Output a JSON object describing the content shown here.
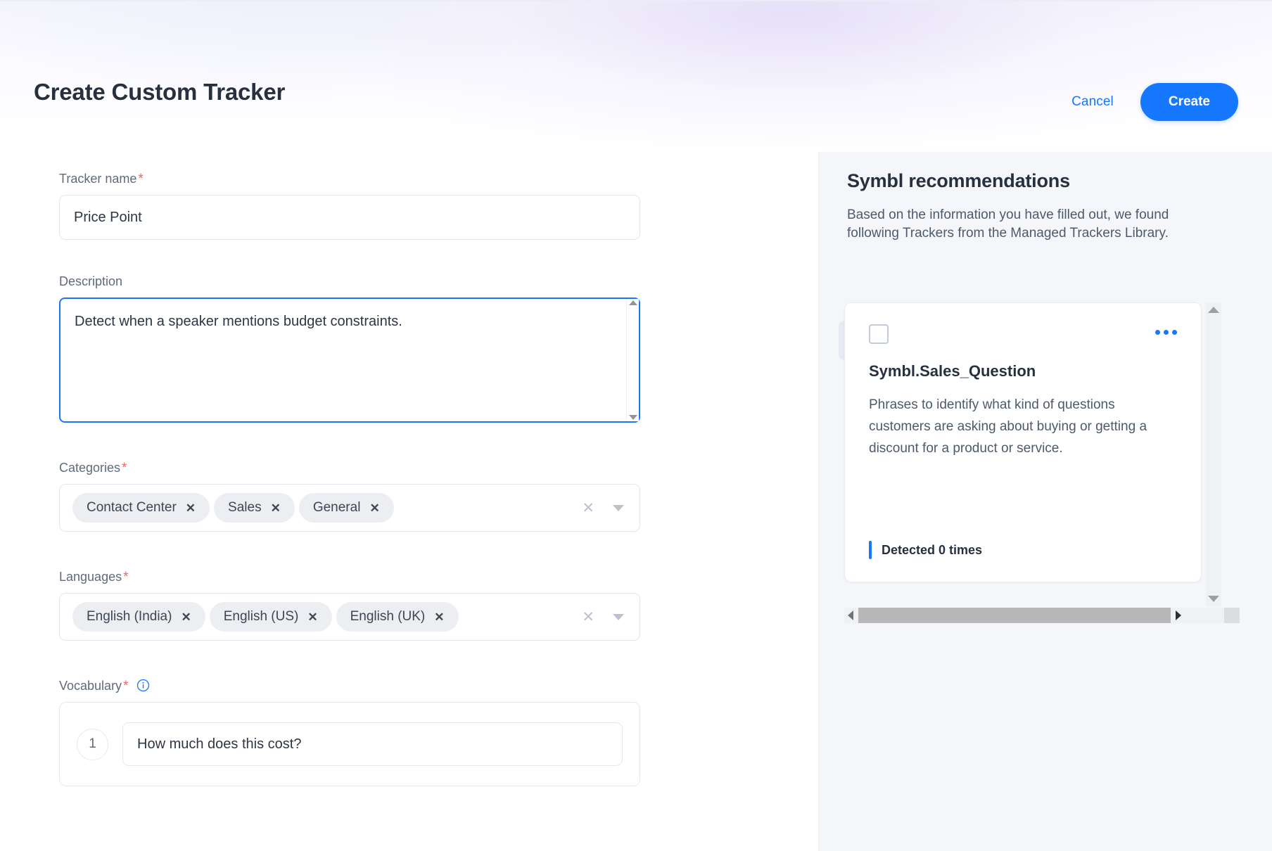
{
  "header": {
    "title": "Create Custom Tracker",
    "cancel_label": "Cancel",
    "create_label": "Create"
  },
  "form": {
    "tracker_name": {
      "label": "Tracker name",
      "required_marker": "*",
      "value": "Price Point",
      "placeholder": "Tracker name"
    },
    "description": {
      "label": "Description",
      "value": "Detect when a speaker mentions budget constraints.",
      "placeholder": "Description"
    },
    "categories": {
      "label": "Categories",
      "required_marker": "*",
      "chips": [
        {
          "label": "Contact Center",
          "remove": "✕"
        },
        {
          "label": "Sales",
          "remove": "✕"
        },
        {
          "label": "General",
          "remove": "✕"
        }
      ],
      "clear_icon": "✕",
      "caret_icon": "chevron-down"
    },
    "languages": {
      "label": "Languages",
      "required_marker": "*",
      "chips": [
        {
          "label": "English (India)",
          "remove": "✕"
        },
        {
          "label": "English (US)",
          "remove": "✕"
        },
        {
          "label": "English (UK)",
          "remove": "✕"
        }
      ],
      "clear_icon": "✕",
      "caret_icon": "chevron-down"
    },
    "vocabulary": {
      "label": "Vocabulary",
      "required_marker": "*",
      "info_icon": "info-circle-icon",
      "items": [
        {
          "number": "1",
          "value": "How much does this cost?",
          "placeholder": "Add phrase"
        }
      ]
    }
  },
  "recommendations": {
    "title": "Symbl recommendations",
    "subtitle": "Based on the information you have filled out, we found following Trackers from the Managed Trackers Library.",
    "card": {
      "checkbox_checked": false,
      "menu_icon": "more-horizontal-icon",
      "name": "Symbl.Sales_Question",
      "description": "Phrases to identify what kind of questions customers are asking about buying or getting a discount for a product or service.",
      "detected_text": "Detected 0 times"
    }
  },
  "colors": {
    "accent": "#1677ff",
    "required": "#f2635f",
    "title": "#27303f",
    "label": "#5f6b7d",
    "panel_bg": "#f4f6fa"
  }
}
